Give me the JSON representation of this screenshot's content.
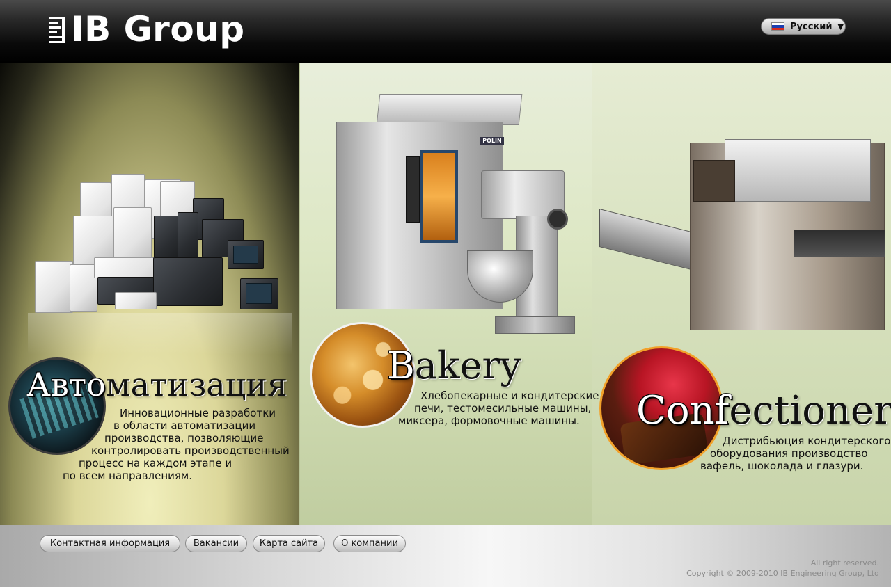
{
  "header": {
    "logo_text": "IB Group",
    "language": {
      "label": "Русский",
      "arrow": "▼",
      "flag_colors": [
        "#ffffff",
        "#1c3fb0",
        "#d52b1e"
      ]
    }
  },
  "panels": {
    "automation": {
      "title_lead": "Авто",
      "title_rest": "матизация",
      "description_lines": [
        "Инновационные разработки",
        "в области автоматизации",
        "производства, позволяющие",
        "контролировать производственный",
        "процесс на каждом этапе и",
        "по всем направлениям."
      ]
    },
    "bakery": {
      "title_lead": "B",
      "title_rest": "akery",
      "brand_badge": "POLIN",
      "description_lines": [
        "Хлебопекарные и кондитерские",
        "печи, тестомесильные машины,",
        "миксера,  формовочные машины."
      ]
    },
    "confectionery": {
      "title_lead": "Conf",
      "title_rest": "ectionery",
      "description_lines": [
        "Дистрибьюция кондитерского",
        "оборудования производство",
        "вафель, шоколада и глазури."
      ]
    }
  },
  "footer": {
    "nav": [
      {
        "label": "Контактная информация"
      },
      {
        "label": "Вакансии"
      },
      {
        "label": "Карта сайта"
      },
      {
        "label": "О компании"
      }
    ],
    "rights": "All right reserved.",
    "copyright": "Copyright © 2009-2010 IB Engineering Group, Ltd"
  },
  "colors": {
    "header_bg": "#000000",
    "bakery_circle_border": "#f2f2f2",
    "confectionery_circle_border": "#f2a12a"
  }
}
